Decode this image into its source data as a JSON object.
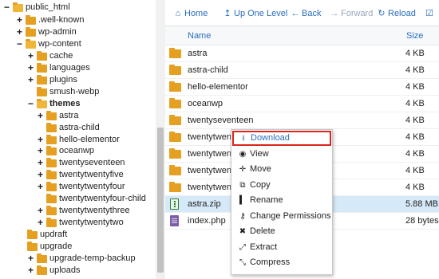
{
  "tree": {
    "items": [
      {
        "label": "public_html",
        "toggle": "−",
        "open": true,
        "bold": false
      },
      {
        "label": ".well-known",
        "toggle": "+",
        "open": false,
        "bold": false
      },
      {
        "label": "wp-admin",
        "toggle": "+",
        "open": false,
        "bold": false
      },
      {
        "label": "wp-content",
        "toggle": "−",
        "open": true,
        "bold": false
      },
      {
        "label": "cache",
        "toggle": "+",
        "open": false,
        "bold": false
      },
      {
        "label": "languages",
        "toggle": "+",
        "open": false,
        "bold": false
      },
      {
        "label": "plugins",
        "toggle": "+",
        "open": false,
        "bold": false
      },
      {
        "label": "smush-webp",
        "toggle": "",
        "open": false,
        "bold": false
      },
      {
        "label": "themes",
        "toggle": "−",
        "open": true,
        "bold": true
      },
      {
        "label": "astra",
        "toggle": "+",
        "open": false,
        "bold": false
      },
      {
        "label": "astra-child",
        "toggle": "",
        "open": false,
        "bold": false
      },
      {
        "label": "hello-elementor",
        "toggle": "+",
        "open": false,
        "bold": false
      },
      {
        "label": "oceanwp",
        "toggle": "+",
        "open": false,
        "bold": false
      },
      {
        "label": "twentyseventeen",
        "toggle": "+",
        "open": false,
        "bold": false
      },
      {
        "label": "twentytwentyfive",
        "toggle": "+",
        "open": false,
        "bold": false
      },
      {
        "label": "twentytwentyfour",
        "toggle": "+",
        "open": false,
        "bold": false
      },
      {
        "label": "twentytwentyfour-child",
        "toggle": "",
        "open": false,
        "bold": false
      },
      {
        "label": "twentytwentythree",
        "toggle": "+",
        "open": false,
        "bold": false
      },
      {
        "label": "twentytwentytwo",
        "toggle": "+",
        "open": false,
        "bold": false
      },
      {
        "label": "updraft",
        "toggle": "",
        "open": false,
        "bold": false
      },
      {
        "label": "upgrade",
        "toggle": "",
        "open": false,
        "bold": false
      },
      {
        "label": "upgrade-temp-backup",
        "toggle": "+",
        "open": false,
        "bold": false
      },
      {
        "label": "uploads",
        "toggle": "+",
        "open": false,
        "bold": false
      }
    ]
  },
  "toolbar": {
    "home": "Home",
    "up": "Up One Level",
    "back": "Back",
    "forward": "Forward",
    "reload": "Reload",
    "select_all_icon": "checkbox-icon"
  },
  "list": {
    "col_name": "Name",
    "col_size": "Size",
    "rows": [
      {
        "name": "astra",
        "size": "4 KB",
        "type": "folder"
      },
      {
        "name": "astra-child",
        "size": "4 KB",
        "type": "folder"
      },
      {
        "name": "hello-elementor",
        "size": "4 KB",
        "type": "folder"
      },
      {
        "name": "oceanwp",
        "size": "4 KB",
        "type": "folder"
      },
      {
        "name": "twentyseventeen",
        "size": "4 KB",
        "type": "folder"
      },
      {
        "name": "twentytwenty",
        "size": "4 KB",
        "type": "folder"
      },
      {
        "name": "twentytwenty",
        "size": "4 KB",
        "type": "folder"
      },
      {
        "name": "twentytwenty",
        "size": "4 KB",
        "type": "folder"
      },
      {
        "name": "twentytwenty",
        "size": "4 KB",
        "type": "folder"
      },
      {
        "name": "astra.zip",
        "size": "5.88 MB",
        "type": "zip"
      },
      {
        "name": "index.php",
        "size": "28 bytes",
        "type": "php"
      }
    ]
  },
  "context_menu": {
    "items": [
      {
        "label": "Download",
        "icon": "download-icon"
      },
      {
        "label": "View",
        "icon": "eye-icon"
      },
      {
        "label": "Move",
        "icon": "move-icon"
      },
      {
        "label": "Copy",
        "icon": "copy-icon"
      },
      {
        "label": "Rename",
        "icon": "rename-icon"
      },
      {
        "label": "Change Permissions",
        "icon": "key-icon"
      },
      {
        "label": "Delete",
        "icon": "delete-icon"
      },
      {
        "label": "Extract",
        "icon": "extract-icon"
      },
      {
        "label": "Compress",
        "icon": "compress-icon"
      }
    ]
  },
  "colors": {
    "accent": "#2a6ebd",
    "folder": "#e5a021",
    "highlight_border": "#d9251c",
    "selected_row": "#d6e9f8"
  }
}
